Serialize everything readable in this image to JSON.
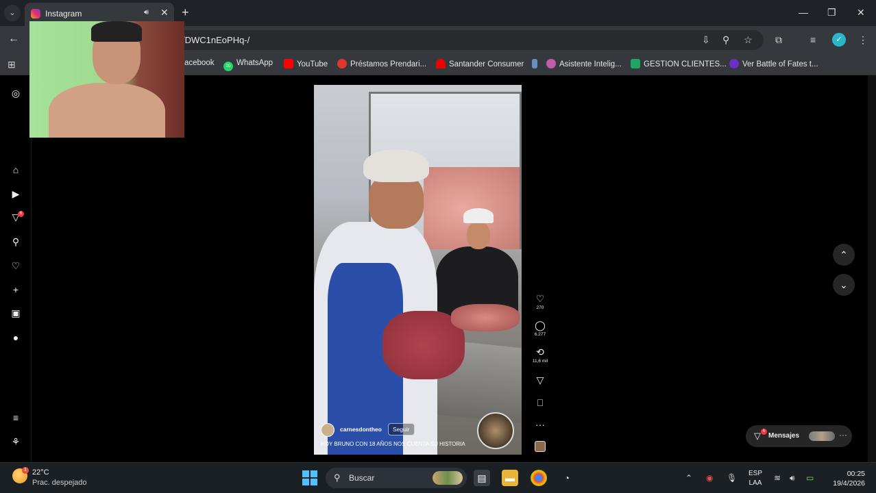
{
  "browser": {
    "tab_title": "Instagram",
    "url": "/DWC1nEoPHq-/",
    "bookmarks": [
      "acebook",
      "WhatsApp",
      "YouTube",
      "Préstamos Prendari...",
      "Santander Consumer",
      "Asistente Intelig...",
      "GESTION CLIENTES...",
      "Ver Battle of Fates t..."
    ],
    "whatsapp_badge": "20"
  },
  "sidebar": {
    "notifications_badge": "6"
  },
  "reel": {
    "author": "carnesdontheo",
    "follow_label": "Seguir",
    "caption": "HOY BRUNO CON 18 AÑOS NOS CUENTA SU HISTORIA",
    "likes": "270",
    "comments": "6.277",
    "reposts": "11,6 mil"
  },
  "messages": {
    "label": "Mensajes",
    "badge": "6"
  },
  "taskbar": {
    "temperature": "22°C",
    "weather": "Prac. despejado",
    "weather_badge": "1",
    "search_placeholder": "Buscar",
    "lang_1": "ESP",
    "lang_2": "LAA",
    "time": "00:25",
    "date": "19/4/2026"
  }
}
